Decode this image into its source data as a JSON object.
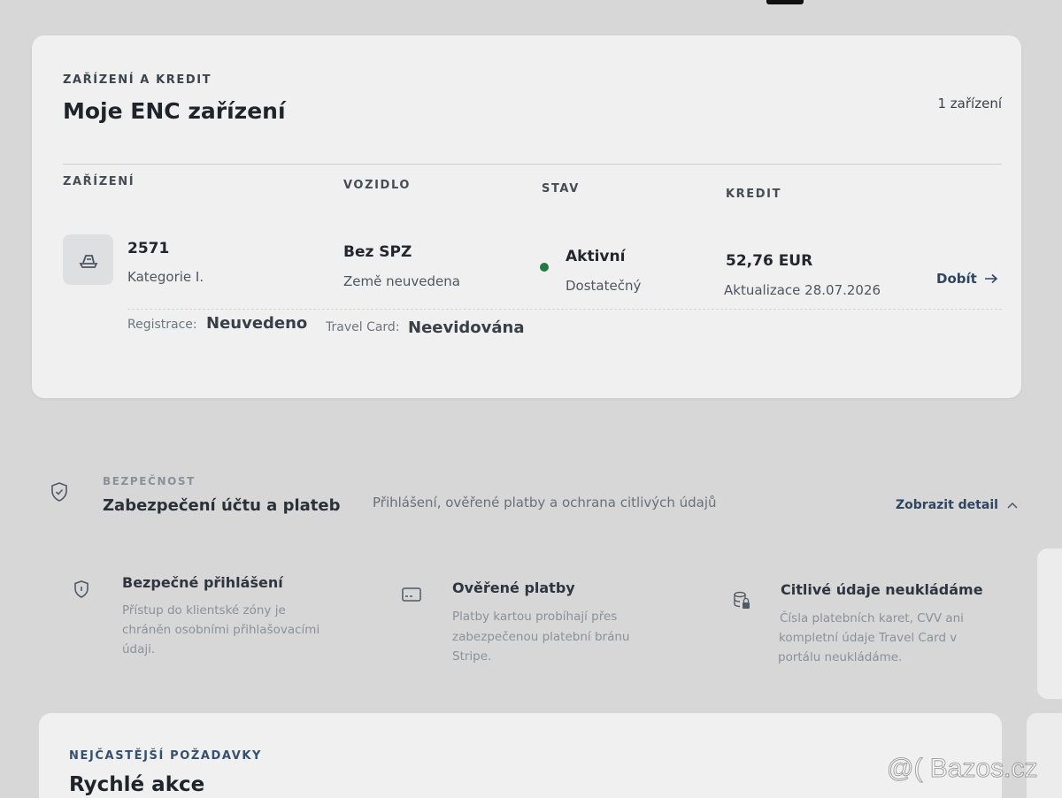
{
  "devices_card": {
    "eyebrow": "ZAŘÍZENÍ A KREDIT",
    "title": "Moje ENC zařízení",
    "count": "1 zařízení",
    "columns": {
      "device": "ZAŘÍZENÍ",
      "vehicle": "VOZIDLO",
      "status": "STAV",
      "credit": "KREDIT"
    },
    "device": {
      "id": "2571",
      "category": "Kategorie I.",
      "vehicle_plate": "Bez SPZ",
      "vehicle_country": "Země neuvedena",
      "status": "Aktivní",
      "status_detail": "Dostatečný",
      "credit": "52,76 EUR",
      "credit_updated": "Aktualizace 28.07.2026",
      "topup_label": "Dobít",
      "registration_label": "Registrace:",
      "registration_value": "Neuvedeno",
      "travelcard_label": "Travel Card:",
      "travelcard_value": "Neevidována"
    },
    "colors": {
      "status_active": "#1f7a3e",
      "link": "#2f4660"
    }
  },
  "security": {
    "eyebrow": "BEZPEČNOST",
    "title": "Zabezpečení účtu a plateb",
    "description": "Přihlášení, ověřené platby a ochrana citlivých údajů",
    "detail_link": "Zobrazit detail",
    "features": [
      {
        "icon": "shield-icon",
        "title": "Bezpečné přihlášení",
        "lines": [
          "Přístup do klientské zóny je",
          "chráněn osobními přihlašovacími",
          "údaji."
        ]
      },
      {
        "icon": "card-icon",
        "title": "Ověřené platby",
        "lines": [
          "Platby kartou probíhají přes",
          "zabezpečenou platební bránu",
          "Stripe."
        ]
      },
      {
        "icon": "database-lock-icon",
        "title": "Citlivé údaje neukládáme",
        "lines": [
          "Čísla platebních karet, CVV ani",
          "kompletní údaje Travel Card v",
          "portálu neukládáme."
        ]
      }
    ]
  },
  "quick_actions": {
    "eyebrow": "NEJČASTĚJŠÍ POŽADAVKY",
    "title": "Rychlé akce"
  },
  "watermark": "@( Bazos.cz"
}
